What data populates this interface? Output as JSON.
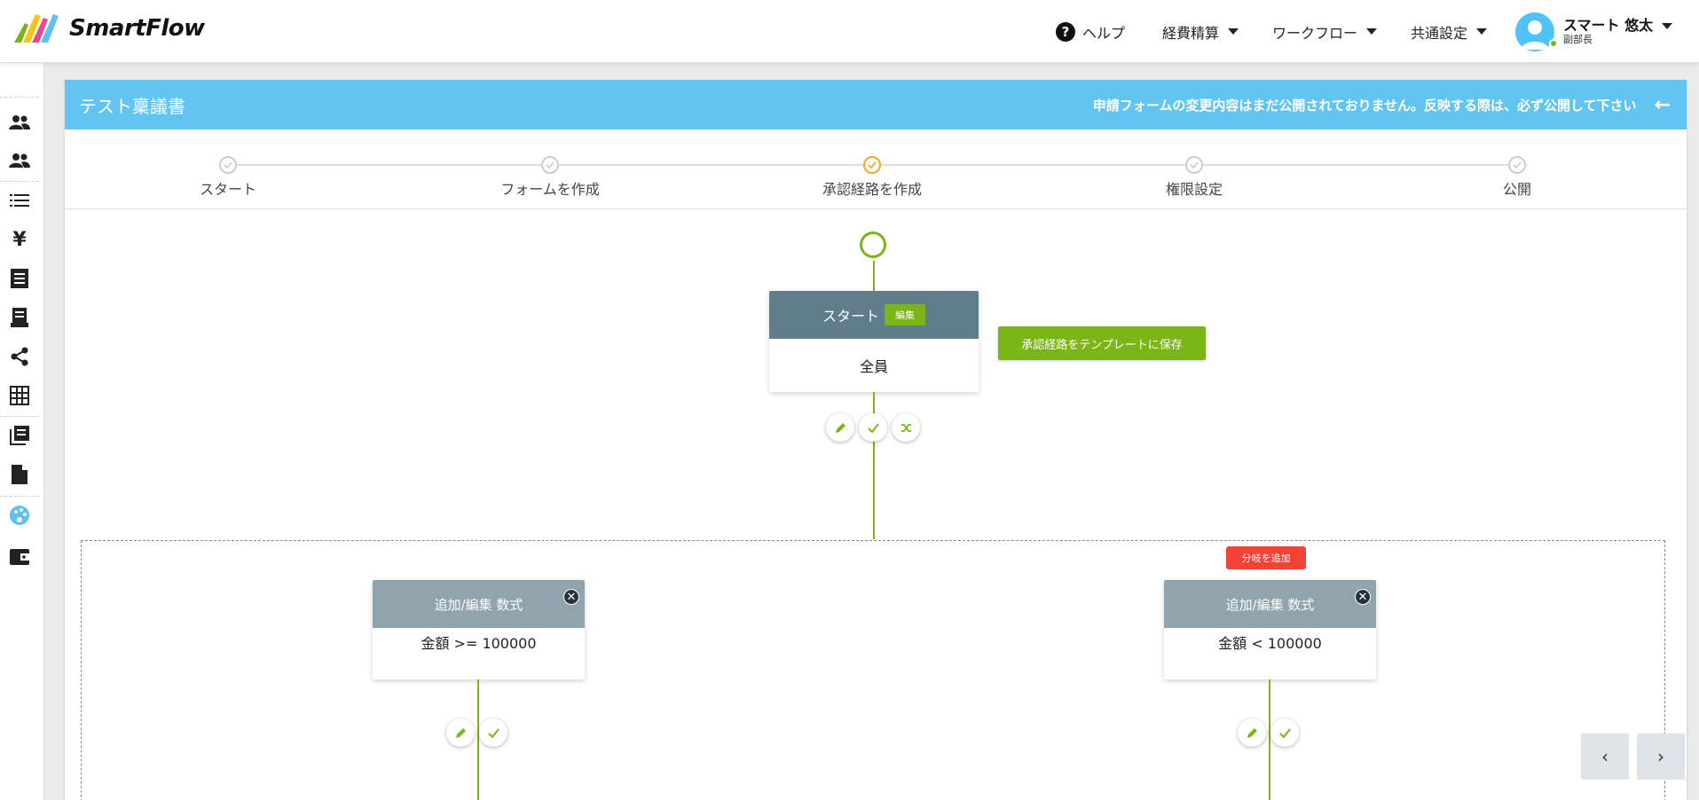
{
  "header": {
    "brand": "SmartFlow",
    "nav": {
      "help": "ヘルプ",
      "expense": "経費精算",
      "workflow": "ワークフロー",
      "common": "共通設定"
    },
    "user": {
      "name": "スマート 悠太",
      "role": "副部長"
    }
  },
  "sidebar": {
    "icons": [
      "users-icon",
      "users-group-icon",
      "list-icon",
      "yen-icon",
      "receipt-icon",
      "invoice-icon",
      "share-icon",
      "grid-icon",
      "library-icon",
      "document-icon",
      "palette-icon",
      "wallet-icon"
    ]
  },
  "panel": {
    "title": "テスト稟議書",
    "notice": "申請フォームの変更内容はまだ公開されておりません。反映する際は、必ず公開して下さい"
  },
  "steps": [
    {
      "label": "スタート",
      "state": "done"
    },
    {
      "label": "フォームを作成",
      "state": "done"
    },
    {
      "label": "承認経路を作成",
      "state": "active"
    },
    {
      "label": "権限設定",
      "state": "done"
    },
    {
      "label": "公開",
      "state": "done"
    }
  ],
  "flow": {
    "start_card": {
      "title": "スタート",
      "edit_badge": "編集",
      "body": "全員"
    },
    "save_template_button": "承認経路をテンプレートに保存",
    "add_branch_button": "分岐を追加",
    "branches": [
      {
        "title": "追加/編集 数式",
        "condition": "金額 >= 100000"
      },
      {
        "title": "追加/編集 数式",
        "condition": "金額 < 100000"
      }
    ]
  },
  "colors": {
    "accent": "#62c4f0",
    "green": "#7cb518",
    "card_head": "#607d8b",
    "card_head_light": "#90a4ae",
    "red": "#f44336",
    "step_active": "#f5a623"
  },
  "pager": {
    "prev": "‹",
    "next": "›"
  }
}
